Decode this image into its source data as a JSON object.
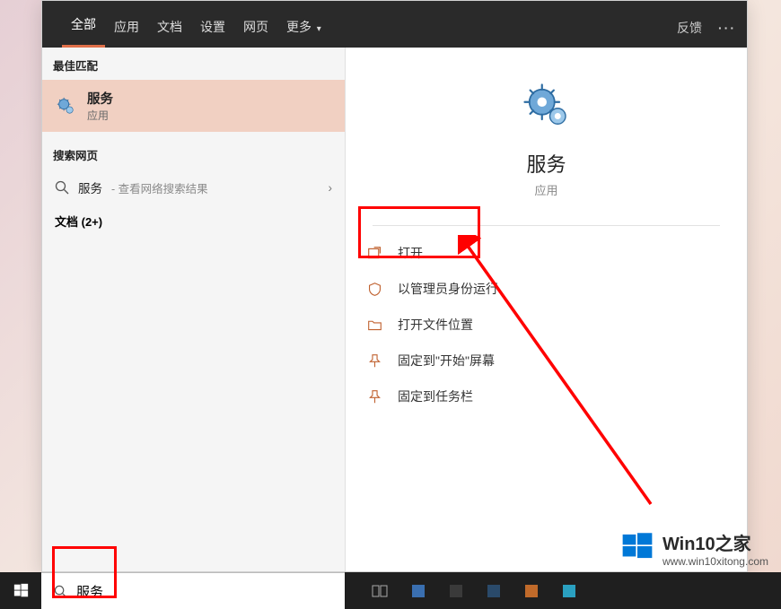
{
  "tabs": {
    "all": "全部",
    "apps": "应用",
    "docs": "文档",
    "settings": "设置",
    "web": "网页",
    "more": "更多"
  },
  "topbar": {
    "feedback": "反馈"
  },
  "left": {
    "best_match_header": "最佳匹配",
    "best_match": {
      "title": "服务",
      "subtitle": "应用"
    },
    "search_web_header": "搜索网页",
    "web_item": {
      "query": "服务",
      "hint": " - 查看网络搜索结果"
    },
    "docs_header": "文档 (2+)"
  },
  "detail": {
    "name": "服务",
    "kind": "应用",
    "actions": {
      "open": "打开",
      "run_admin": "以管理员身份运行",
      "open_location": "打开文件位置",
      "pin_start": "固定到\"开始\"屏幕",
      "pin_taskbar": "固定到任务栏"
    }
  },
  "searchbox": {
    "value": "服务"
  },
  "watermark": {
    "title": "Win10之家",
    "url": "www.win10xitong.com"
  }
}
